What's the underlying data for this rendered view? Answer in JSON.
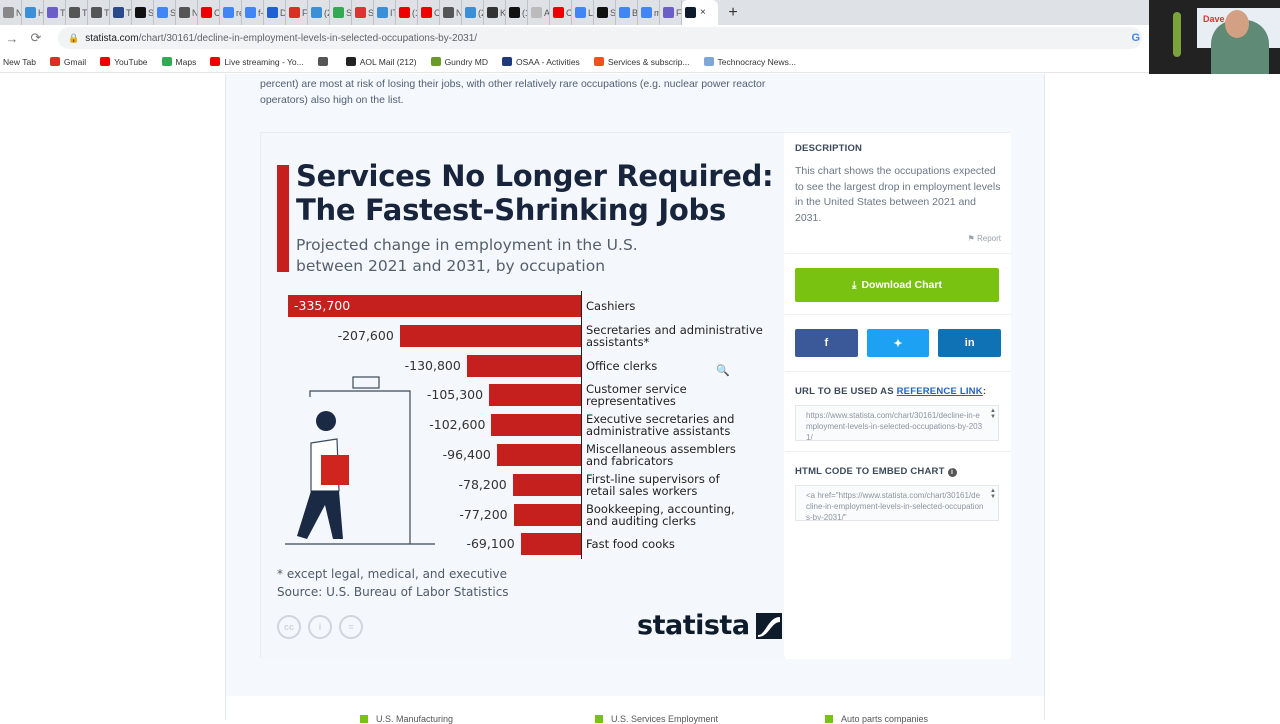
{
  "browser": {
    "tabs": [
      {
        "label": "Ne",
        "icon": "globe-icon",
        "color": "#888"
      },
      {
        "label": "He",
        "icon": "cloud-icon",
        "color": "#3a8fd6"
      },
      {
        "label": "Th",
        "icon": "tile-icon",
        "color": "#6b5fc7"
      },
      {
        "label": "Th",
        "icon": "globe-icon",
        "color": "#555"
      },
      {
        "label": "Th",
        "icon": "globe-icon",
        "color": "#555"
      },
      {
        "label": "Th",
        "icon": "news-icon",
        "color": "#2c4a8a"
      },
      {
        "label": "St",
        "icon": "nf-icon",
        "color": "#111"
      },
      {
        "label": "ST",
        "icon": "google-icon",
        "color": "#4285f4"
      },
      {
        "label": "Ne",
        "icon": "chrome-icon",
        "color": "#555"
      },
      {
        "label": "Cr",
        "icon": "youtube-icon",
        "color": "#e00"
      },
      {
        "label": "re",
        "icon": "google-icon",
        "color": "#4285f4"
      },
      {
        "label": "f-",
        "icon": "google-icon",
        "color": "#4285f4"
      },
      {
        "label": "Di",
        "icon": "shield-icon",
        "color": "#1f5fd1"
      },
      {
        "label": "Fi",
        "icon": "gmail-icon",
        "color": "#d93025"
      },
      {
        "label": "(2",
        "icon": "home-icon",
        "color": "#3a8fd6"
      },
      {
        "label": "St",
        "icon": "maps-icon",
        "color": "#34a853"
      },
      {
        "label": "Se",
        "icon": "lock-icon",
        "color": "#d33"
      },
      {
        "label": "IT",
        "icon": "cloud-icon",
        "color": "#3a8fd6"
      },
      {
        "label": "(1",
        "icon": "youtube-icon",
        "color": "#e00"
      },
      {
        "label": "Cl",
        "icon": "youtube-icon",
        "color": "#e00"
      },
      {
        "label": "Ne",
        "icon": "chrome-icon",
        "color": "#555"
      },
      {
        "label": "(2",
        "icon": "home-icon",
        "color": "#3a8fd6"
      },
      {
        "label": "Kl",
        "icon": "news-icon",
        "color": "#333"
      },
      {
        "label": "(1",
        "icon": "x-icon",
        "color": "#111"
      },
      {
        "label": "Ar",
        "icon": "mail-icon",
        "color": "#bbb"
      },
      {
        "label": "Cl",
        "icon": "youtube-icon",
        "color": "#e00"
      },
      {
        "label": "Li",
        "icon": "google-icon",
        "color": "#4285f4"
      },
      {
        "label": "St",
        "icon": "q-icon",
        "color": "#111"
      },
      {
        "label": "Bk",
        "icon": "google-icon",
        "color": "#4285f4"
      },
      {
        "label": "m",
        "icon": "google-icon",
        "color": "#4285f4"
      },
      {
        "label": "Fr",
        "icon": "tile-icon",
        "color": "#6b5fc7"
      }
    ],
    "active_tab": {
      "icon": "statista-icon",
      "close": "×"
    },
    "new_tab": "+",
    "url_host": "statista.com",
    "url_path": "/chart/30161/decline-in-employment-levels-in-selected-occupations-by-2031/",
    "bookmarks": [
      {
        "label": "New Tab",
        "icon": "",
        "color": ""
      },
      {
        "label": "Gmail",
        "icon": "gmail-icon",
        "color": "#d93025"
      },
      {
        "label": "YouTube",
        "icon": "youtube-icon",
        "color": "#e00"
      },
      {
        "label": "Maps",
        "icon": "maps-icon",
        "color": "#34a853"
      },
      {
        "label": "Live streaming - Yo...",
        "icon": "youtube-icon",
        "color": "#e00"
      },
      {
        "label": "",
        "icon": "globe-icon",
        "color": "#555"
      },
      {
        "label": "AOL Mail (212)",
        "icon": "aol-icon",
        "color": "#222"
      },
      {
        "label": "Gundry MD",
        "icon": "leaf-icon",
        "color": "#6a9a2a"
      },
      {
        "label": "OSAA - Activities",
        "icon": "osaa-icon",
        "color": "#1e3a7a"
      },
      {
        "label": "Services & subscrip...",
        "icon": "windows-icon",
        "color": "#f25022"
      },
      {
        "label": "Technocracy News...",
        "icon": "globe-icon",
        "color": "#7fa7d6"
      }
    ],
    "webcam_name": "Dave Hodges",
    "webcam_screen_text": "Dave H"
  },
  "article": {
    "intro": "percent) are most at risk of losing their jobs, with other relatively rare occupations (e.g. nuclear power reactor operators) also high on the list."
  },
  "chart_data": {
    "type": "bar",
    "orientation": "horizontal",
    "title_line1": "Services No Longer Required:",
    "title_line2": "The Fastest-Shrinking Jobs",
    "subtitle_line1": "Projected change in employment in the U.S.",
    "subtitle_line2": "between 2021 and 2031, by occupation",
    "categories": [
      [
        "Cashiers"
      ],
      [
        "Secretaries and administrative",
        "assistants*"
      ],
      [
        "Office clerks"
      ],
      [
        "Customer service",
        "representatives"
      ],
      [
        "Executive secretaries and",
        "administrative assistants"
      ],
      [
        "Miscellaneous assemblers",
        "and fabricators"
      ],
      [
        "First-line supervisors of",
        "retail sales workers"
      ],
      [
        "Bookkeeping, accounting,",
        "and auditing clerks"
      ],
      [
        "Fast food cooks"
      ]
    ],
    "values": [
      -335700,
      -207600,
      -130800,
      -105300,
      -102600,
      -96400,
      -78200,
      -77200,
      -69100
    ],
    "value_labels": [
      "-335,700",
      "-207,600",
      "-130,800",
      "-105,300",
      "-102,600",
      "-96,400",
      "-78,200",
      "-77,200",
      "-69,100"
    ],
    "bar_color": "#c5201e",
    "xlim": [
      -335700,
      0
    ],
    "footnote": "* except legal, medical, and executive",
    "source": "Source: U.S. Bureau of Labor Statistics",
    "license_icons": [
      "cc",
      "by",
      "nd"
    ],
    "brand": "statista"
  },
  "sidebar": {
    "description_heading": "DESCRIPTION",
    "description": "This chart shows the occupations expected to see the largest drop in employment levels in the United States between 2021 and 2031.",
    "report": "Report",
    "download_label": "Download Chart",
    "share": {
      "facebook": "f",
      "twitter": "🐦",
      "linkedin": "in"
    },
    "url_heading_prefix": "URL TO BE USED AS ",
    "url_heading_link": "REFERENCE LINK",
    "url_heading_suffix": ":",
    "url_value": "https://www.statista.com/chart/30161/decline-in-employment-levels-in-selected-occupations-by-2031/",
    "embed_heading": "HTML CODE TO EMBED CHART",
    "embed_value": "<a href=\"https://www.statista.com/chart/30161/decline-in-employment-levels-in-selected-occupations-by-2031/\""
  },
  "related": [
    {
      "label": "U.S. Manufacturing"
    },
    {
      "label": "U.S. Services Employment"
    },
    {
      "label": "Auto parts companies"
    }
  ],
  "colors": {
    "accent_green": "#7ac212",
    "chart_red": "#c5201e",
    "title_navy": "#17243b"
  }
}
